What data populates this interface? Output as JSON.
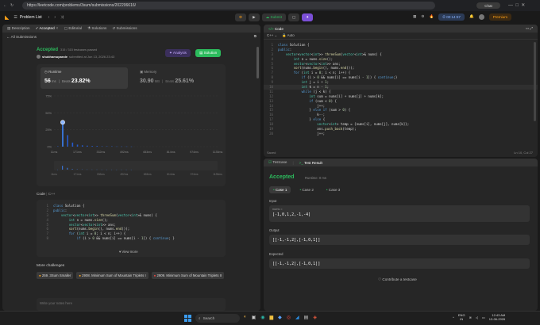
{
  "browser": {
    "url": "https://leetcode.com/problems/3sum/submissions/202206616/"
  },
  "nav": {
    "problem_list": "Problem List",
    "submit": "Submit",
    "timer": "00:14:57",
    "premium": "Premium"
  },
  "left": {
    "tabs": [
      "Description",
      "Accepted",
      "Editorial",
      "Solutions",
      "Submissions"
    ],
    "all_submissions": "All Submissions",
    "status": "Accepted",
    "cases": "315 / 315 testcases passed",
    "user": "shubhamupande",
    "submitted": "submitted at Jun 13, 2026 23:43",
    "editorial_btn": "Analysis",
    "solution_btn": "Solution",
    "runtime_label": "Runtime",
    "runtime_val": "56",
    "runtime_unit": "ms",
    "runtime_beats_label": "Beats",
    "runtime_beats": "23.82%",
    "memory_label": "Memory",
    "memory_val": "30.90",
    "memory_unit": "MB",
    "memory_beats_label": "Beats",
    "memory_beats": "25.61%",
    "code_label": "Code",
    "code_lang": "C++",
    "view_more": "View more",
    "more_challenges": "More challenges",
    "challenges": [
      "259. 3Sum Smaller",
      "2908. Minimum Sum of Mountain Triplets I",
      "2909. Minimum Sum of Mountain Triplets II"
    ],
    "note_placeholder": "Write your notes here"
  },
  "chart_data": {
    "type": "bar",
    "ylabel_ticks": [
      "75%",
      "50%",
      "25%",
      "0%"
    ],
    "ylim": [
      0,
      75
    ],
    "x_ticks": [
      "11ms",
      "171ms",
      "332ms",
      "492ms",
      "653ms",
      "814ms",
      "974ms",
      "1135ms"
    ],
    "values": [
      0.5,
      36,
      17,
      6,
      3,
      2,
      1.5,
      1,
      1,
      0.5,
      0.5,
      0.5,
      0.3,
      0.3,
      0.3,
      0.2
    ],
    "highlight_index": 1
  },
  "editor": {
    "title": "Code",
    "lang": "C++",
    "auto": "Auto",
    "saved": "Saved",
    "cursor": "Ln 10, Col 27"
  },
  "code_right": [
    "class Solution {",
    "public:",
    "    vector<vector<int>> threeSum(vector<int>& nums) {",
    "        int n = nums.size();",
    "        vector<vector<int>> ans;",
    "        sort(nums.begin(), nums.end());",
    "        for (int i = 0; i < n; i++) {",
    "            if (i > 0 && nums[i] == nums[i - 1]) { continue;}",
    "            int j = i + 1;",
    "            int k = n - 1;",
    "            while (j < k) {",
    "                int sum = nums[i] + nums[j] + nums[k];",
    "                if (sum < 0) {",
    "                    j++;",
    "                } else if (sum > 0) {",
    "                    k--;",
    "                } else {",
    "                    vector<int> temp = {nums[i], nums[j], nums[k]};",
    "                    ans.push_back(temp);",
    "                    j++;"
  ],
  "code_left": [
    "class Solution {",
    "public:",
    "    vector<vector<int>> threeSum(vector<int>& nums) {",
    "        int n = nums.size();",
    "        vector<vector<int>> ans;",
    "        sort(nums.begin(), nums.end());",
    "        for (int i = 0; i < n; i++) {",
    "            if (i > 0 && nums[i] == nums[i - 1]) { continue; }"
  ],
  "result": {
    "tab_testcase": "Testcase",
    "tab_result": "Test Result",
    "status": "Accepted",
    "runtime": "Runtime: 0 ms",
    "cases": [
      "Case 1",
      "Case 2",
      "Case 3"
    ],
    "input_label": "Input",
    "input_var": "nums =",
    "input_val": "[-1,0,1,2,-1,-4]",
    "output_label": "Output",
    "output_val": "[[-1,-1,2],[-1,0,1]]",
    "expected_label": "Expected",
    "expected_val": "[[-1,-1,2],[-1,0,1]]",
    "contribute": "Contribute a testcase"
  },
  "taskbar": {
    "search": "Search",
    "lang1": "ENG",
    "lang2": "IN",
    "time": "12:43 AM",
    "date": "13-06-2026"
  },
  "colors": {
    "accent_green": "#2cbb5d",
    "accent_orange": "#ffa116",
    "purple": "#7b4fd6"
  }
}
